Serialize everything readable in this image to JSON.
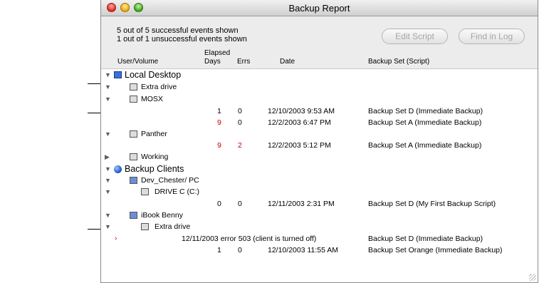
{
  "window": {
    "title": "Backup Report"
  },
  "summary": {
    "successful": "5 out of 5 successful events shown",
    "unsuccessful": "1 out of 1 unsuccessful events shown"
  },
  "toolbar": {
    "edit_script": "Edit Script",
    "find_in_log": "Find in Log"
  },
  "columns": {
    "user_volume": "User/Volume",
    "elapsed": "Elapsed",
    "days": "Days",
    "errs": "Errs",
    "date": "Date",
    "backup_set": "Backup Set (Script)"
  },
  "rows": [
    {
      "kind": "group",
      "expand": "▼",
      "label": "Local Desktop",
      "icon": "desktop-icon"
    },
    {
      "kind": "item",
      "expand": "▼",
      "label": "Extra drive",
      "icon": "drive-icon"
    },
    {
      "kind": "item",
      "expand": "▼",
      "label": "MOSX",
      "icon": "drive-icon"
    },
    {
      "kind": "event",
      "days": "1",
      "errs": "0",
      "date": "12/10/2003 9:53 AM",
      "set": "Backup Set D (Immediate Backup)",
      "days_color": "#000000",
      "errs_color": "#000000"
    },
    {
      "kind": "event",
      "days": "9",
      "errs": "0",
      "date": "12/2/2003 6:47 PM",
      "set": "Backup Set A (Immediate Backup)",
      "days_color": "#cc0000",
      "errs_color": "#000000"
    },
    {
      "kind": "item",
      "expand": "▼",
      "label": "Panther",
      "icon": "drive-icon"
    },
    {
      "kind": "event",
      "days": "9",
      "errs": "2",
      "date": "12/2/2003 5:12 PM",
      "set": "Backup Set A (Immediate Backup)",
      "days_color": "#cc0000",
      "errs_color": "#cc0000"
    },
    {
      "kind": "item",
      "expand": "▶",
      "label": "Working",
      "icon": "drive-icon"
    },
    {
      "kind": "group",
      "expand": "▼",
      "label": "Backup Clients",
      "icon": "globe-icon"
    },
    {
      "kind": "item",
      "expand": "▼",
      "label": "Dev_Chester/ PC",
      "icon": "client-pc-icon"
    },
    {
      "kind": "subitem",
      "expand": "▼",
      "label": "DRIVE C (C:)",
      "icon": "drive-icon"
    },
    {
      "kind": "event",
      "days": "0",
      "errs": "0",
      "date": "12/11/2003 2:31 PM",
      "set": "Backup Set D (My First Backup Script)",
      "days_color": "#000000",
      "errs_color": "#000000"
    },
    {
      "kind": "item",
      "expand": "▼",
      "label": "iBook Benny",
      "icon": "client-mac-icon"
    },
    {
      "kind": "subitem",
      "expand": "▼",
      "label": "Extra drive",
      "icon": "drive-icon"
    },
    {
      "kind": "error",
      "mark": "›",
      "text": "12/11/2003 error 503 (client is turned off)",
      "set": "Backup Set D (Immediate Backup)"
    },
    {
      "kind": "event",
      "days": "1",
      "errs": "0",
      "date": "12/10/2003 11:55 AM",
      "set": "Backup Set Orange (Immediate Backup)",
      "days_color": "#000000",
      "errs_color": "#000000"
    }
  ]
}
